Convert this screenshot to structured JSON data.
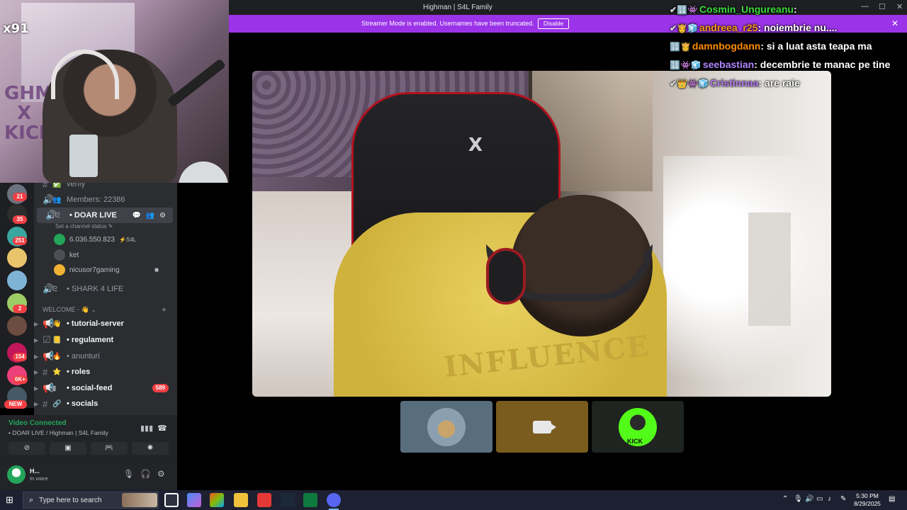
{
  "window": {
    "title": "Highman | S4L Family",
    "minimize": "—",
    "maximize": "☐",
    "close": "✕"
  },
  "banner": {
    "message": "Streamer Mode is enabled. Usernames have been truncated.",
    "disable_label": "Disable",
    "close": "✕"
  },
  "facecam": {
    "viewer_badge": "x91",
    "poster_text": "GHMQ\nX\nKICK"
  },
  "rail": {
    "badges": [
      "21",
      "35",
      "251",
      "2",
      "154",
      "6K+",
      "NEW"
    ]
  },
  "channels": {
    "items": [
      {
        "icon": "#",
        "emoji": "✅",
        "name": "verify",
        "bold": false
      },
      {
        "icon": "🔊",
        "emoji": "👥",
        "name": "Members: 22386",
        "bold": false
      },
      {
        "icon": "🔊",
        "emoji": "ᘓ",
        "name": "• DOAR LIVE",
        "bold": true,
        "selected": true
      },
      {
        "icon": "🔊",
        "emoji": "ᘓ",
        "name": "• SHARK 4 LIFE",
        "bold": false
      },
      {
        "icon": "📢",
        "emoji": "👋",
        "name": "• tutorial-server",
        "bold": true
      },
      {
        "icon": "☑",
        "emoji": "📒",
        "name": "• regulament",
        "bold": true
      },
      {
        "icon": "📢",
        "emoji": "🔥",
        "name": "• anunturi",
        "bold": false
      },
      {
        "icon": "#",
        "emoji": "⭐",
        "name": "• roles",
        "bold": true
      },
      {
        "icon": "📢",
        "emoji": "▮",
        "name": "• social-feed",
        "bold": true,
        "pill": "589"
      },
      {
        "icon": "#",
        "emoji": "🔗",
        "name": "• socials",
        "bold": true
      }
    ],
    "status_line": "Set a channel status ✎",
    "category": "WELCOME - 👋 ⌄",
    "voice_users": [
      {
        "name": "6.036.550.823",
        "tag": "⚡S4L"
      },
      {
        "name": "ket",
        "tag": ""
      },
      {
        "name": "nicusor7gaming",
        "tag": ""
      }
    ]
  },
  "voice_panel": {
    "status": "Video Connected",
    "location": "• DOAR LIVE / Highman | S4L Family"
  },
  "user_panel": {
    "name": "H...",
    "status": "In voice"
  },
  "chat": [
    {
      "badges": "✔🔢👾",
      "user": "Cosmin_Ungureanu",
      "user_color": "#3cdd3c",
      "text": ""
    },
    {
      "badges": "✔👸🧊",
      "user": "andreea_r25",
      "user_color": "#ff9a1c",
      "text": "noiembrie nu...."
    },
    {
      "badges": "🔢👸",
      "user": "damnbogdann",
      "user_color": "#ff8c00",
      "text": "si a luat asta teapa ma"
    },
    {
      "badges": "🔢👾🧊",
      "user": "seebastian",
      "user_color": "#b084ff",
      "text": "decembrie te manac pe tine"
    },
    {
      "badges": "✔👑👾🧊",
      "user": "Cristinnaa",
      "user_color": "#b57cf0",
      "text": "are raie"
    }
  ],
  "stream": {
    "chair_logo": "X",
    "hoodie_text": "INFLUENCE"
  },
  "thumbs": {
    "kick_label": "KICK"
  },
  "taskbar": {
    "search_placeholder": "Type here to search",
    "time": "5:30 PM",
    "date": "8/29/2025"
  },
  "colors": {
    "banner": "#9b34e8",
    "discord_dark": "#2b2d31",
    "connected_green": "#23a55a",
    "kick_green": "#53fc18"
  }
}
